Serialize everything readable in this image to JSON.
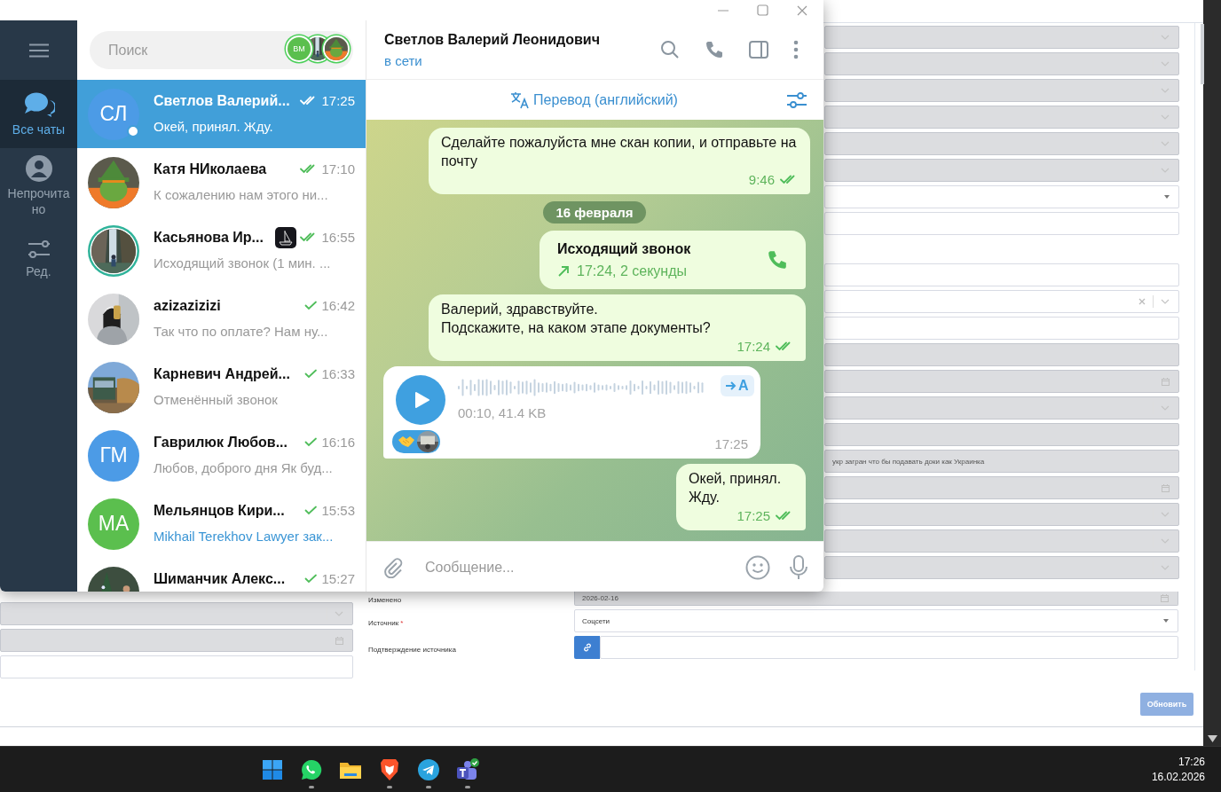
{
  "telegram": {
    "sidebar": {
      "items": [
        {
          "kind": "chats",
          "label": "Все чаты",
          "selected": true
        },
        {
          "kind": "unread",
          "label": "Непрочитано",
          "selected": false
        },
        {
          "kind": "edit",
          "label": "Ред.",
          "selected": false
        }
      ]
    },
    "search": {
      "placeholder": "Поиск",
      "story_initials": "BM"
    },
    "chats": [
      {
        "name": "Светлов Валерий...",
        "time": "17:25",
        "read": true,
        "preview": "Окей, принял. Жду.",
        "accent": false,
        "selected": true,
        "online": true,
        "story": false,
        "emoji_status": false,
        "avatar": {
          "kind": "initials",
          "text": "СЛ",
          "color": "#4c9be6"
        }
      },
      {
        "name": "Катя НИколаева",
        "time": "17:10",
        "read": true,
        "preview": "К сожалению нам этого ни...",
        "accent": false,
        "selected": false,
        "online": false,
        "story": false,
        "emoji_status": false
      },
      {
        "name": "Касьянова Ир...",
        "time": "16:55",
        "read": true,
        "preview": "Исходящий звонок (1 мин. ...",
        "accent": false,
        "selected": false,
        "online": false,
        "story": true,
        "emoji_status": true
      },
      {
        "name": "azizazizizi",
        "time": "16:42",
        "read": false,
        "preview": "Так что по оплате?  Нам ну...",
        "accent": false,
        "selected": false,
        "online": false,
        "story": false,
        "emoji_status": false
      },
      {
        "name": "Карневич Андрей...",
        "time": "16:33",
        "read": false,
        "preview": "Отменённый звонок",
        "accent": false,
        "selected": false,
        "online": false,
        "story": false,
        "emoji_status": false
      },
      {
        "name": "Гаврилюк Любов...",
        "time": "16:16",
        "read": false,
        "preview": "Любов, доброго дня Як буд...",
        "accent": false,
        "selected": false,
        "online": false,
        "story": false,
        "emoji_status": false,
        "avatar": {
          "kind": "initials",
          "text": "ГМ",
          "color": "#4c9be6"
        }
      },
      {
        "name": "Мельянцов Кири...",
        "time": "15:53",
        "read": false,
        "preview": "Mikhail Terekhov Lawyer зак...",
        "accent": true,
        "selected": false,
        "online": false,
        "story": false,
        "emoji_status": false,
        "avatar": {
          "kind": "initials",
          "text": "МА",
          "color": "#5bbf4e"
        }
      },
      {
        "name": "Шиманчик Алекс...",
        "time": "15:27",
        "read": false,
        "selected": false,
        "online": false,
        "story": false,
        "emoji_status": false
      }
    ],
    "chat": {
      "title": "Светлов Валерий Леонидович",
      "status": "в сети",
      "translate": "Перевод (английский)",
      "messages": [
        {
          "kind": "text",
          "outgoing": true,
          "text": "Сделайте пожалуйста мне скан копии, и отправьте на почту",
          "time": "9:46",
          "read": true
        },
        {
          "kind": "date",
          "text": "16 февраля"
        },
        {
          "kind": "call",
          "outgoing": true,
          "title": "Исходящий звонок",
          "detail": "17:24, 2 секунды"
        },
        {
          "kind": "text",
          "outgoing": true,
          "text": "Валерий, здравствуйте.\nПодскажите, на каком этапе документы?",
          "time": "17:24",
          "read": true
        },
        {
          "kind": "voice",
          "outgoing": false,
          "info": "00:10, 41.4 KB",
          "transcribe": "A",
          "reacted": true,
          "time": "17:25"
        },
        {
          "kind": "text",
          "outgoing": true,
          "text": "Окей, принял.\nЖду.",
          "time": "17:25",
          "read": true
        }
      ],
      "composer": {
        "placeholder": "Сообщение..."
      }
    }
  },
  "form": {
    "groups": [
      [
        {
          "kind": "select",
          "disabled": true
        },
        {
          "kind": "select",
          "disabled": true
        },
        {
          "kind": "select",
          "disabled": true
        },
        {
          "kind": "select",
          "disabled": true
        },
        {
          "kind": "select",
          "disabled": true
        },
        {
          "kind": "select",
          "disabled": true
        },
        {
          "kind": "dropdown",
          "disabled": false
        },
        {
          "kind": "text",
          "disabled": false
        }
      ],
      [
        {
          "kind": "text",
          "disabled": false
        },
        {
          "kind": "select-clear",
          "disabled": false
        },
        {
          "kind": "text",
          "disabled": false
        },
        {
          "kind": "text",
          "disabled": true
        },
        {
          "kind": "date",
          "disabled": true
        },
        {
          "kind": "select",
          "disabled": true
        },
        {
          "kind": "text",
          "disabled": true
        },
        {
          "kind": "text",
          "disabled": true,
          "value": "укр загран что бы подавать доки как Украинка"
        },
        {
          "kind": "date",
          "disabled": true
        },
        {
          "kind": "select",
          "disabled": true
        },
        {
          "kind": "select",
          "disabled": true
        },
        {
          "kind": "select",
          "disabled": true
        },
        {
          "kind": "date",
          "disabled": true,
          "label": "Изменено",
          "value": "2026-02-16"
        },
        {
          "kind": "dropdown",
          "disabled": false,
          "label": "Источник",
          "required_mark": "*",
          "value": "Соцсети"
        },
        {
          "kind": "link",
          "disabled": false,
          "label": "Подтверждение источника"
        }
      ]
    ],
    "left_fields": [
      {
        "kind": "select",
        "disabled": true
      },
      {
        "kind": "date",
        "disabled": true
      },
      {
        "kind": "text",
        "disabled": false
      }
    ],
    "update_button": "Обновить"
  },
  "taskbar": {
    "apps": [
      {
        "kind": "start",
        "running": false
      },
      {
        "kind": "whatsapp",
        "running": true
      },
      {
        "kind": "files",
        "running": false
      },
      {
        "kind": "brave",
        "running": true
      },
      {
        "kind": "telegram",
        "running": true
      },
      {
        "kind": "teams",
        "running": true
      }
    ],
    "time": "17:26",
    "date": "16.02.2026"
  }
}
